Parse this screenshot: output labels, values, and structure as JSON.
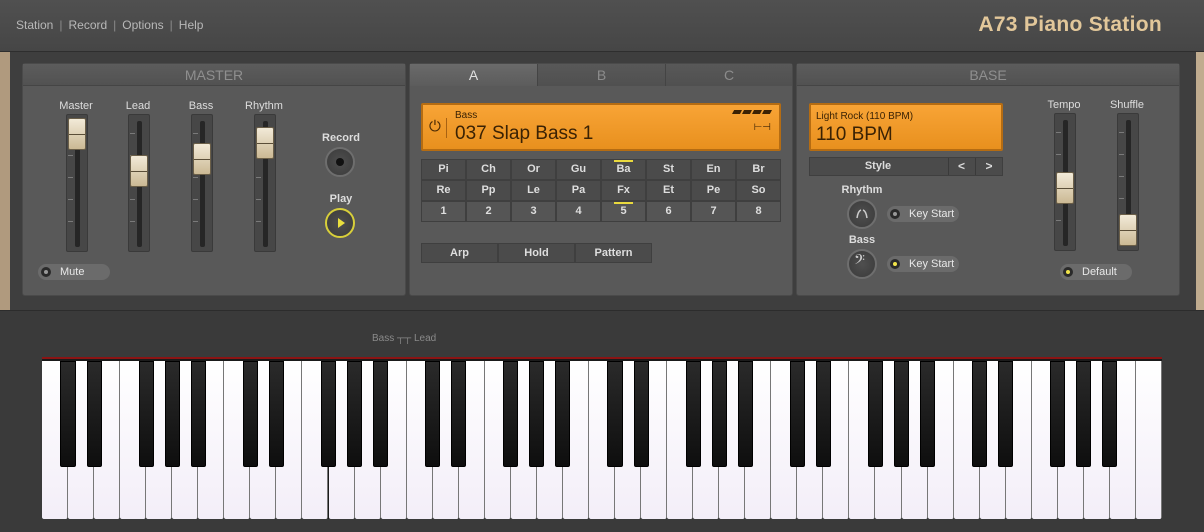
{
  "menu": {
    "items": [
      "Station",
      "Record",
      "Options",
      "Help"
    ]
  },
  "app_title": "A73 Piano Station",
  "master": {
    "title": "MASTER",
    "sliders": [
      {
        "label": "Master",
        "level": 0.88
      },
      {
        "label": "Lead",
        "level": 0.62
      },
      {
        "label": "Bass",
        "level": 0.72
      },
      {
        "label": "Rhythm",
        "level": 0.85
      }
    ],
    "mute_label": "Mute",
    "record_label": "Record",
    "play_label": "Play"
  },
  "tabs": [
    "A",
    "B",
    "C"
  ],
  "lcd_main": {
    "sub": "Bass",
    "name": "037 Slap Bass 1"
  },
  "instrument_rows": [
    [
      "Pi",
      "Ch",
      "Or",
      "Gu",
      "Ba",
      "St",
      "En",
      "Br"
    ],
    [
      "Re",
      "Pp",
      "Le",
      "Pa",
      "Fx",
      "Et",
      "Pe",
      "So"
    ],
    [
      "1",
      "2",
      "3",
      "4",
      "5",
      "6",
      "7",
      "8"
    ]
  ],
  "mode_buttons": [
    "Arp",
    "Hold",
    "Pattern"
  ],
  "base": {
    "title": "BASE",
    "lcd_sub": "Light Rock (110 BPM)",
    "lcd_main": "110 BPM",
    "style_label": "Style",
    "style_prev": "<",
    "style_next": ">",
    "rhythm_label": "Rhythm",
    "bass_label": "Bass",
    "key_start_1": "Key Start",
    "key_start_2": "Key Start",
    "tempo_label": "Tempo",
    "shuffle_label": "Shuffle",
    "tempo_level": 0.45,
    "shuffle_level": 0.18,
    "default_label": "Default"
  },
  "keyboard": {
    "split_label": "Bass ┬┬ Lead",
    "white_keys": 43
  },
  "colors": {
    "accent": "#f8a436",
    "title": "#e2c79a",
    "indicator": "#f1e44a"
  }
}
